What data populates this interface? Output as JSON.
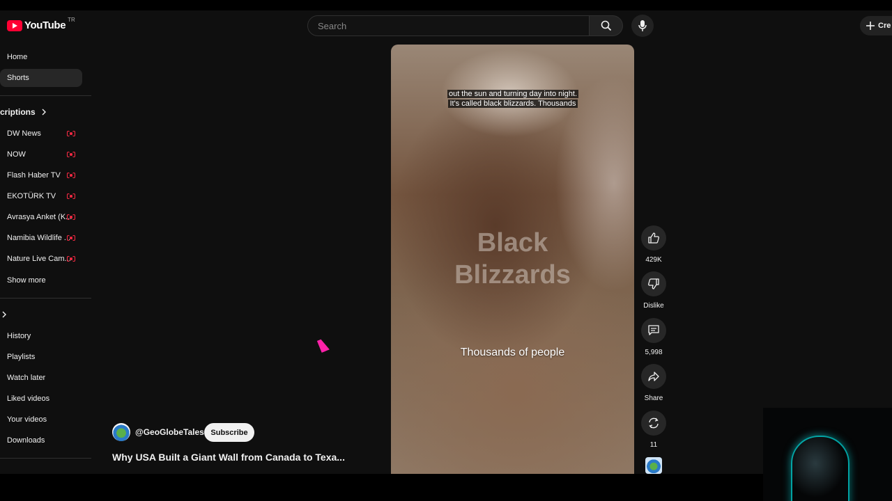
{
  "header": {
    "logo_text": "YouTube",
    "region": "TR",
    "search_placeholder": "Search",
    "create_label": "Cre"
  },
  "sidebar": {
    "main": [
      {
        "label": "Home"
      },
      {
        "label": "Shorts",
        "active": true
      }
    ],
    "subscriptions_title": "criptions",
    "subscriptions": [
      {
        "label": "DW News",
        "live": true
      },
      {
        "label": "NOW",
        "live": true
      },
      {
        "label": "Flash Haber TV",
        "live": true
      },
      {
        "label": "EKOTÜRK TV",
        "live": true
      },
      {
        "label": "Avrasya Anket (K...",
        "live": true
      },
      {
        "label": "Namibia Wildlife ...",
        "live": true
      },
      {
        "label": "Nature Live Cam...",
        "live": true
      }
    ],
    "show_more": "Show more",
    "you": [
      {
        "label": "History"
      },
      {
        "label": "Playlists"
      },
      {
        "label": "Watch later"
      },
      {
        "label": "Liked videos"
      },
      {
        "label": "Your videos"
      },
      {
        "label": "Downloads"
      }
    ]
  },
  "video": {
    "caption_line1": "out the sun and turning day into night.",
    "caption_line2": "It's called black blizzards. Thousands",
    "overlay_title_line1": "Black",
    "overlay_title_line2": "Blizzards",
    "subtitle": "Thousands of people",
    "channel": "@GeoGlobeTales",
    "subscribe_label": "Subscribe",
    "title": "Why USA Built a Giant Wall from Canada to Texa..."
  },
  "actions": {
    "likes": "429K",
    "dislike_label": "Dislike",
    "comments": "5,998",
    "share_label": "Share",
    "remix": "11"
  },
  "colors": {
    "background": "#0f0f0f",
    "brand_red": "#ff0033",
    "live_red": "#ff2a45"
  }
}
